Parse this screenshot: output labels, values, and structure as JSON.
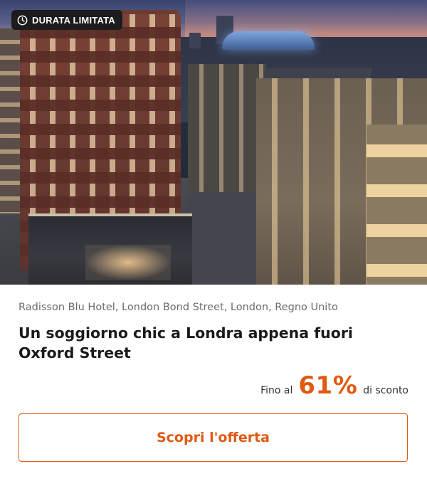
{
  "badge": {
    "label": "DURATA LIMITATA",
    "icon": "clock-icon"
  },
  "hotel": {
    "location": "Radisson Blu Hotel, London Bond Street, London, Regno Unito",
    "title": "Un soggiorno chic a Londra appena fuori Oxford Street"
  },
  "discount": {
    "prefix": "Fino al",
    "value": "61%",
    "suffix": "di sconto"
  },
  "cta": {
    "label": "Scopri l'offerta"
  },
  "colors": {
    "accent": "#e05a12",
    "badge_bg": "#1c1c1e"
  }
}
